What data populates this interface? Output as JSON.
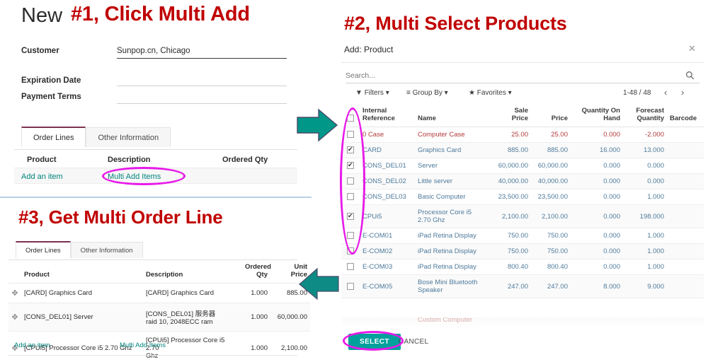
{
  "annotations": {
    "step1": "#1, Click Multi Add",
    "step2": "#2, Multi Select Products",
    "step3": "#3, Get Multi Order Line",
    "color": "#c00000"
  },
  "quotation_form": {
    "title": "New",
    "fields": [
      {
        "label": "Customer",
        "value": "Sunpop.cn, Chicago"
      },
      {
        "label": "Expiration Date",
        "value": ""
      },
      {
        "label": "Payment Terms",
        "value": ""
      }
    ],
    "tabs": [
      {
        "label": "Order Lines",
        "active": true
      },
      {
        "label": "Other Information",
        "active": false
      }
    ],
    "order_lines_headers": [
      "Product",
      "Description",
      "Ordered Qty"
    ],
    "links": {
      "add_item": "Add an item",
      "multi_add": "Multi Add Items"
    },
    "highlight_color": "#e81ae8"
  },
  "result_form": {
    "tabs": [
      {
        "label": "Order Lines",
        "active": true
      },
      {
        "label": "Other Information",
        "active": false
      }
    ],
    "headers": {
      "drag": "",
      "product": "Product",
      "description": "Description",
      "ordered_qty": "Ordered\nQty",
      "ordered_qty_l1": "Ordered",
      "ordered_qty_l2": "Qty",
      "unit_price_l1": "Unit",
      "unit_price_l2": "Price"
    },
    "rows": [
      {
        "product": "[CARD] Graphics Card",
        "description": "[CARD] Graphics Card",
        "description2": "",
        "ordered_qty": "1.000",
        "unit_price": "885.00"
      },
      {
        "product": "[CONS_DEL01] Server",
        "description": "[CONS_DEL01] 服务器",
        "description2": "raid 10, 2048ECC ram",
        "ordered_qty": "1.000",
        "unit_price": "60,000.00"
      },
      {
        "product": "[CPUi5] Processor Core i5 2.70 Ghz",
        "description": "[CPUi5] Processor Core i5 2.70",
        "description2": "Ghz",
        "ordered_qty": "1.000",
        "unit_price": "2,100.00"
      }
    ],
    "links": {
      "add_item": "Add an item",
      "multi_add": "Multi Add Items"
    }
  },
  "product_dialog": {
    "title": "Add: Product",
    "close_icon": "close-icon",
    "search": {
      "placeholder": "Search...",
      "value": "",
      "icon": "search-icon"
    },
    "filterbar": {
      "filters": "Filters",
      "group_by": "Group By",
      "favorites": "Favorites",
      "pager": "1-48 / 48",
      "prev_icon": "chevron-left-icon",
      "next_icon": "chevron-right-icon"
    },
    "headers": {
      "internal_reference_l1": "Internal",
      "internal_reference_l2": "Reference",
      "name": "Name",
      "sale_price_l1": "Sale",
      "sale_price_l2": "Price",
      "price": "Price",
      "qoh_l1": "Quantity On",
      "qoh_l2": "Hand",
      "forecast_l1": "Forecast",
      "forecast_l2": "Quantity",
      "barcode": "Barcode"
    },
    "rows": [
      {
        "checked": false,
        "archived": true,
        "reference": "0 Case",
        "name": "Computer Case",
        "name2": "",
        "sale_price": "25.00",
        "price": "25.00",
        "qoh": "0.000",
        "forecast": "-2.000",
        "barcode": ""
      },
      {
        "checked": true,
        "archived": false,
        "reference": "CARD",
        "name": "Graphics Card",
        "name2": "",
        "sale_price": "885.00",
        "price": "885.00",
        "qoh": "16.000",
        "forecast": "13.000",
        "barcode": ""
      },
      {
        "checked": true,
        "archived": false,
        "reference": "CONS_DEL01",
        "name": "Server",
        "name2": "",
        "sale_price": "60,000.00",
        "price": "60,000.00",
        "qoh": "0.000",
        "forecast": "0.000",
        "barcode": ""
      },
      {
        "checked": false,
        "archived": false,
        "reference": "CONS_DEL02",
        "name": "Little server",
        "name2": "",
        "sale_price": "40,000.00",
        "price": "40,000.00",
        "qoh": "0.000",
        "forecast": "0.000",
        "barcode": ""
      },
      {
        "checked": false,
        "archived": false,
        "reference": "CONS_DEL03",
        "name": "Basic Computer",
        "name2": "",
        "sale_price": "23,500.00",
        "price": "23,500.00",
        "qoh": "0.000",
        "forecast": "1.000",
        "barcode": ""
      },
      {
        "checked": true,
        "archived": false,
        "reference": "CPUi5",
        "name": "Processor Core i5",
        "name2": "2.70 Ghz",
        "sale_price": "2,100.00",
        "price": "2,100.00",
        "qoh": "0.000",
        "forecast": "198.000",
        "barcode": ""
      },
      {
        "checked": false,
        "archived": false,
        "reference": "E-COM01",
        "name": "iPad Retina Display",
        "name2": "",
        "sale_price": "750.00",
        "price": "750.00",
        "qoh": "0.000",
        "forecast": "1.000",
        "barcode": ""
      },
      {
        "checked": false,
        "archived": false,
        "reference": "E-COM02",
        "name": "iPad Retina Display",
        "name2": "",
        "sale_price": "750.00",
        "price": "750.00",
        "qoh": "0.000",
        "forecast": "1.000",
        "barcode": ""
      },
      {
        "checked": false,
        "archived": false,
        "reference": "E-COM03",
        "name": "iPad Retina Display",
        "name2": "",
        "sale_price": "800.40",
        "price": "800.40",
        "qoh": "0.000",
        "forecast": "1.000",
        "barcode": ""
      },
      {
        "checked": false,
        "archived": false,
        "reference": "E-COM05",
        "name": "Bose Mini Bluetooth",
        "name2": "Speaker",
        "sale_price": "247.00",
        "price": "247.00",
        "qoh": "8.000",
        "forecast": "9.000",
        "barcode": ""
      }
    ],
    "cut_off_row": "Custom Computer",
    "buttons": {
      "select": "SELECT",
      "cancel": "CANCEL"
    },
    "accent_color": "#00a09d",
    "link_color": "#4e7a9b",
    "archived_color": "#b23a3a"
  },
  "arrows": {
    "right_arrow": "arrow-right-icon",
    "left_arrow": "arrow-left-icon",
    "color": "#009688"
  }
}
